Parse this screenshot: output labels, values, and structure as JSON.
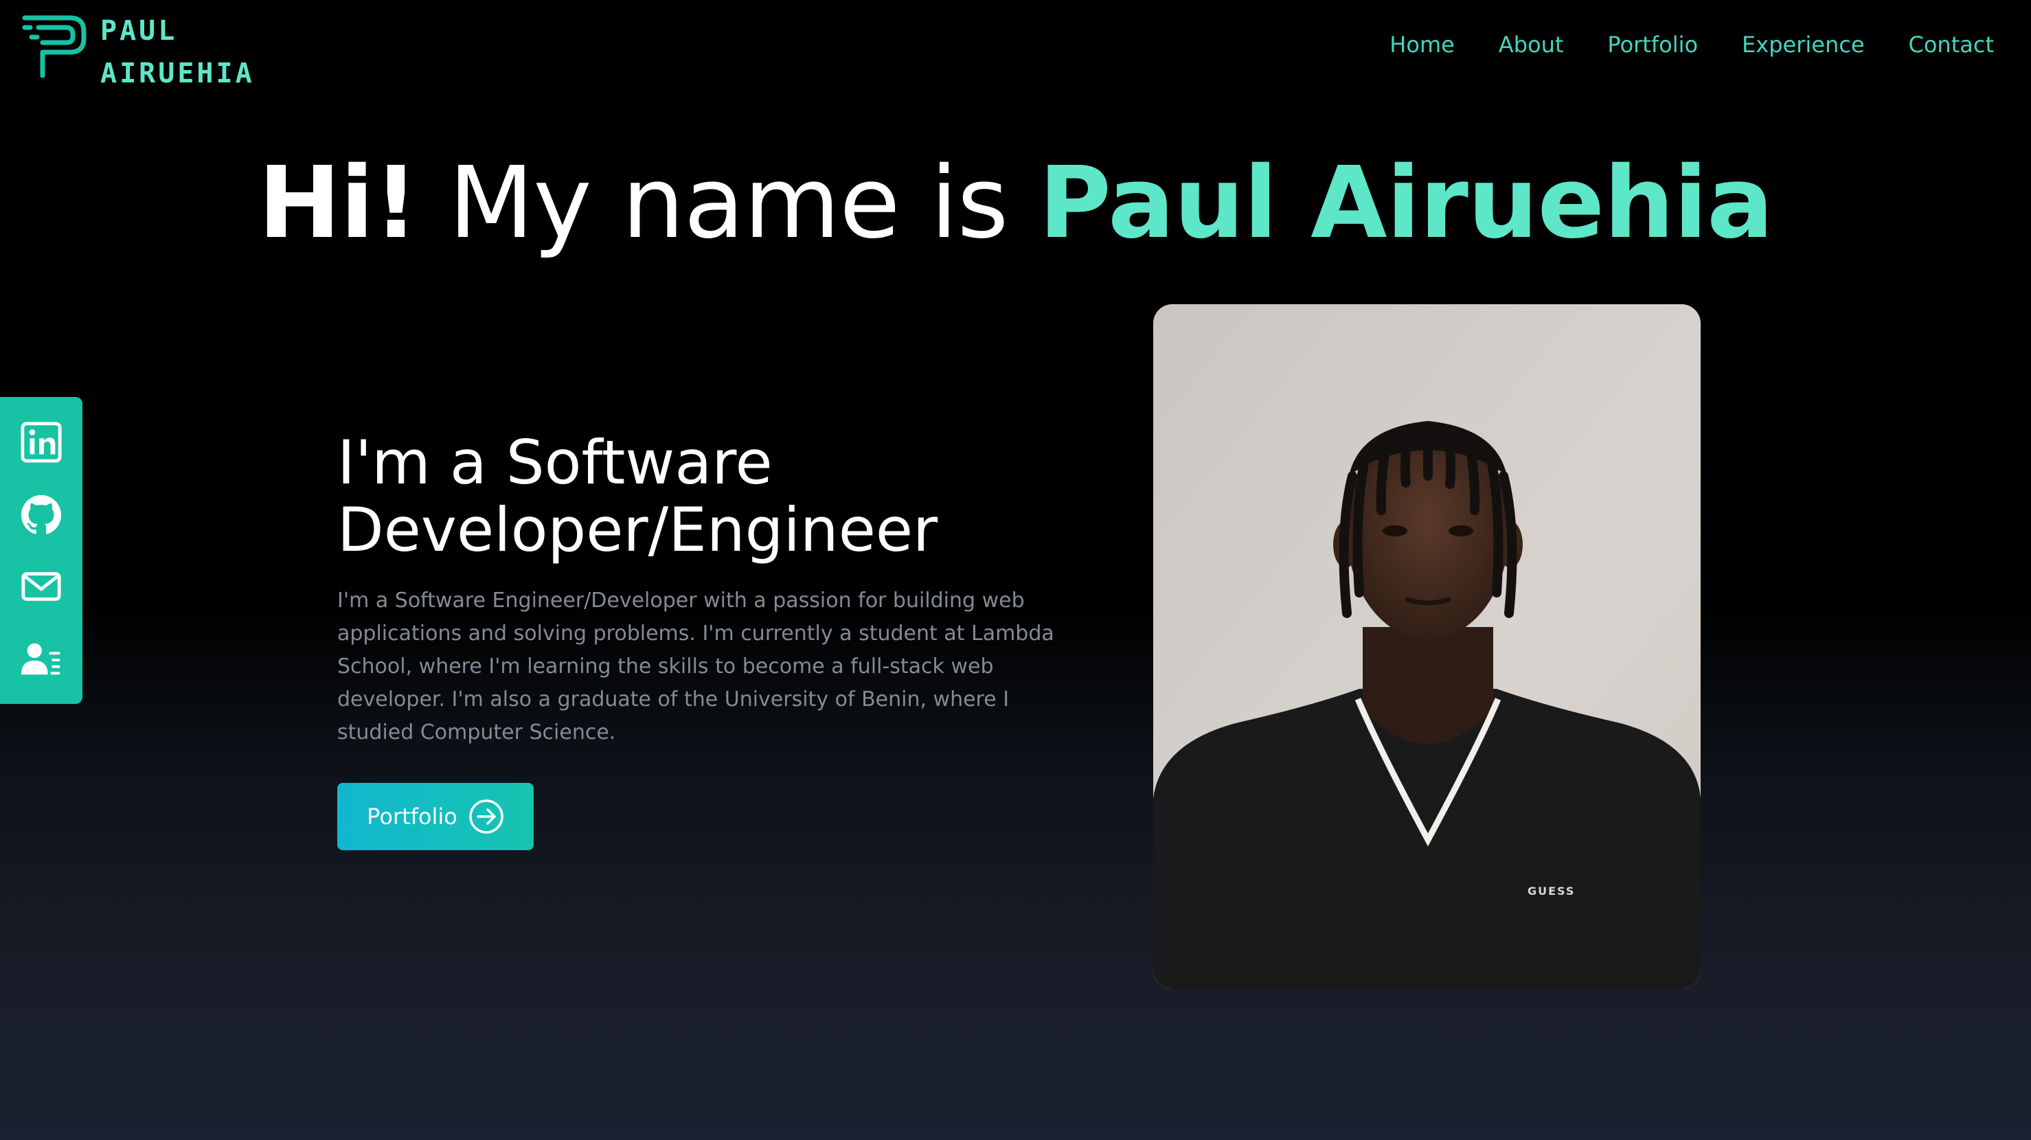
{
  "brand": {
    "line1": "PAUL",
    "line2": "AIRUEHIA",
    "accent": "#5ee6c8",
    "nav_color": "#43d6bd"
  },
  "nav": {
    "items": [
      {
        "label": "Home"
      },
      {
        "label": "About"
      },
      {
        "label": "Portfolio"
      },
      {
        "label": "Experience"
      },
      {
        "label": "Contact"
      }
    ]
  },
  "hero": {
    "greeting": "Hi!",
    "intro_phrase": " My name is ",
    "name": "Paul Airuehia"
  },
  "social": {
    "background": "#17c2a5",
    "icons": [
      "linkedin-icon",
      "github-icon",
      "mail-icon",
      "contact-card-icon"
    ]
  },
  "about": {
    "heading_line1": "I'm a Software",
    "heading_line2": "Developer/Engineer",
    "description": "I'm a Software Engineer/Developer with a passion for building web applications and solving problems. I'm currently a student at Lambda School, where I'm learning the skills to become a full-stack web developer. I'm also a graduate of the University of Benin, where I studied Computer Science.",
    "button_label": "Portfolio",
    "button_icon": "arrow-right-circle-icon"
  },
  "photo": {
    "shirt_logo": "GUESS"
  }
}
